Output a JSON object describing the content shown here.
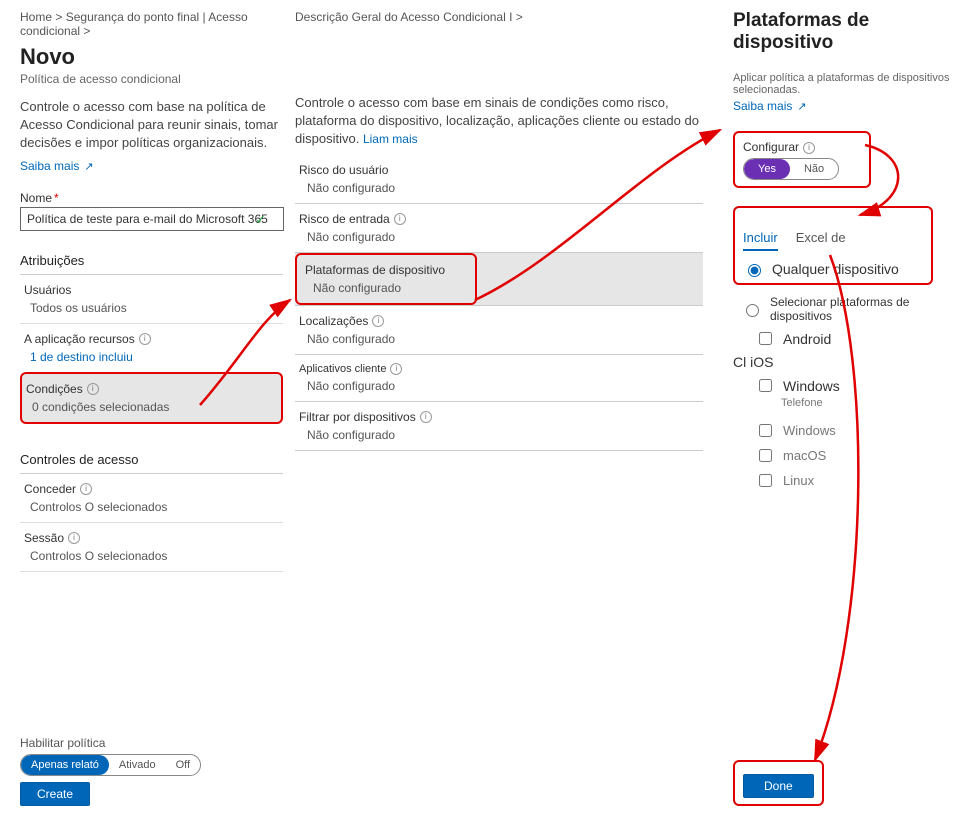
{
  "breadcrumbs": {
    "home": "Home",
    "sep": ">",
    "seg": "Segurança do ponto final | Acesso condicional",
    "sep2": ">",
    "cond": "Descrição Geral do Acesso Condicional I",
    "sep3": ">"
  },
  "page": {
    "title": "Novo",
    "subtitle": "Política de acesso condicional"
  },
  "left": {
    "desc": "Controle o acesso com base na política de Acesso Condicional para reunir sinais, tomar decisões e impor políticas organizacionais.",
    "learn": "Saiba mais",
    "name_label": "Nome",
    "name_value": "Política de teste para e-mail do Microsoft 365",
    "assignments": "Atribuições",
    "users": {
      "label": "Usuários",
      "value": "Todos os usuários"
    },
    "apps": {
      "label": "A aplicação recursos",
      "value": "1 de destino incluiu"
    },
    "conditions": {
      "label": "Condições",
      "value": "0 condições selecionadas"
    },
    "access": "Controles de acesso",
    "grant": {
      "label": "Conceder",
      "value": "Controlos O selecionados"
    },
    "session": {
      "label": "Sessão",
      "value": "Controlos O selecionados"
    }
  },
  "mid": {
    "desc": "Controle o acesso com base em sinais de condições como risco, plataforma do dispositivo, localização, aplicações cliente ou estado do dispositivo.",
    "learn": "Liam mais",
    "items": [
      {
        "label": "Risco do usuário",
        "value": "Não configurado"
      },
      {
        "label": "Risco de entrada",
        "value": "Não configurado"
      },
      {
        "label": "Plataformas de dispositivo",
        "value": "Não configurado"
      },
      {
        "label": "Localizações",
        "value": "Não configurado"
      },
      {
        "label": "Aplicativos cliente",
        "value": "Não configurado"
      },
      {
        "label": "Filtrar por dispositivos",
        "value": "Não configurado"
      }
    ]
  },
  "right": {
    "title": "Plataformas de dispositivo",
    "desc": "Aplicar política a plataformas de dispositivos selecionadas.",
    "learn": "Saiba mais",
    "configure": "Configurar",
    "yes": "Yes",
    "no": "Não",
    "tab_include": "Incluir",
    "tab_exclude": "Excel de",
    "radio_any": "Qualquer dispositivo",
    "radio_select": "Selecionar plataformas de dispositivos",
    "platforms": {
      "android": "Android",
      "cl_ios": "Cl iOS",
      "windows": "Windows",
      "phone": "Telefone",
      "windows2": "Windows",
      "macos": "macOS",
      "linux": "Linux"
    },
    "done": "Done"
  },
  "bottom": {
    "enable": "Habilitar política",
    "report": "Apenas relató",
    "on": "Ativado",
    "off": "Off",
    "create": "Create"
  }
}
